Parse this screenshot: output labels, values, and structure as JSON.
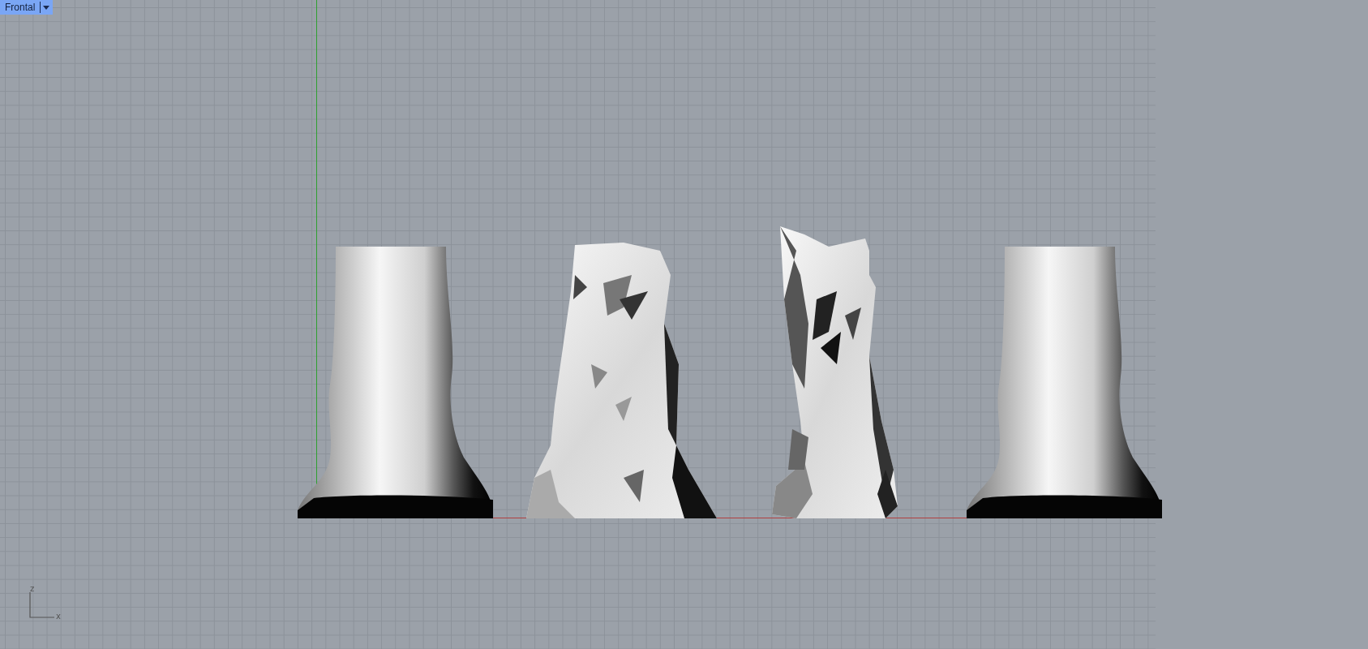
{
  "viewport": {
    "title": "Frontal",
    "active": true
  },
  "axis_indicator": {
    "vertical_label": "z",
    "horizontal_label": "x"
  }
}
